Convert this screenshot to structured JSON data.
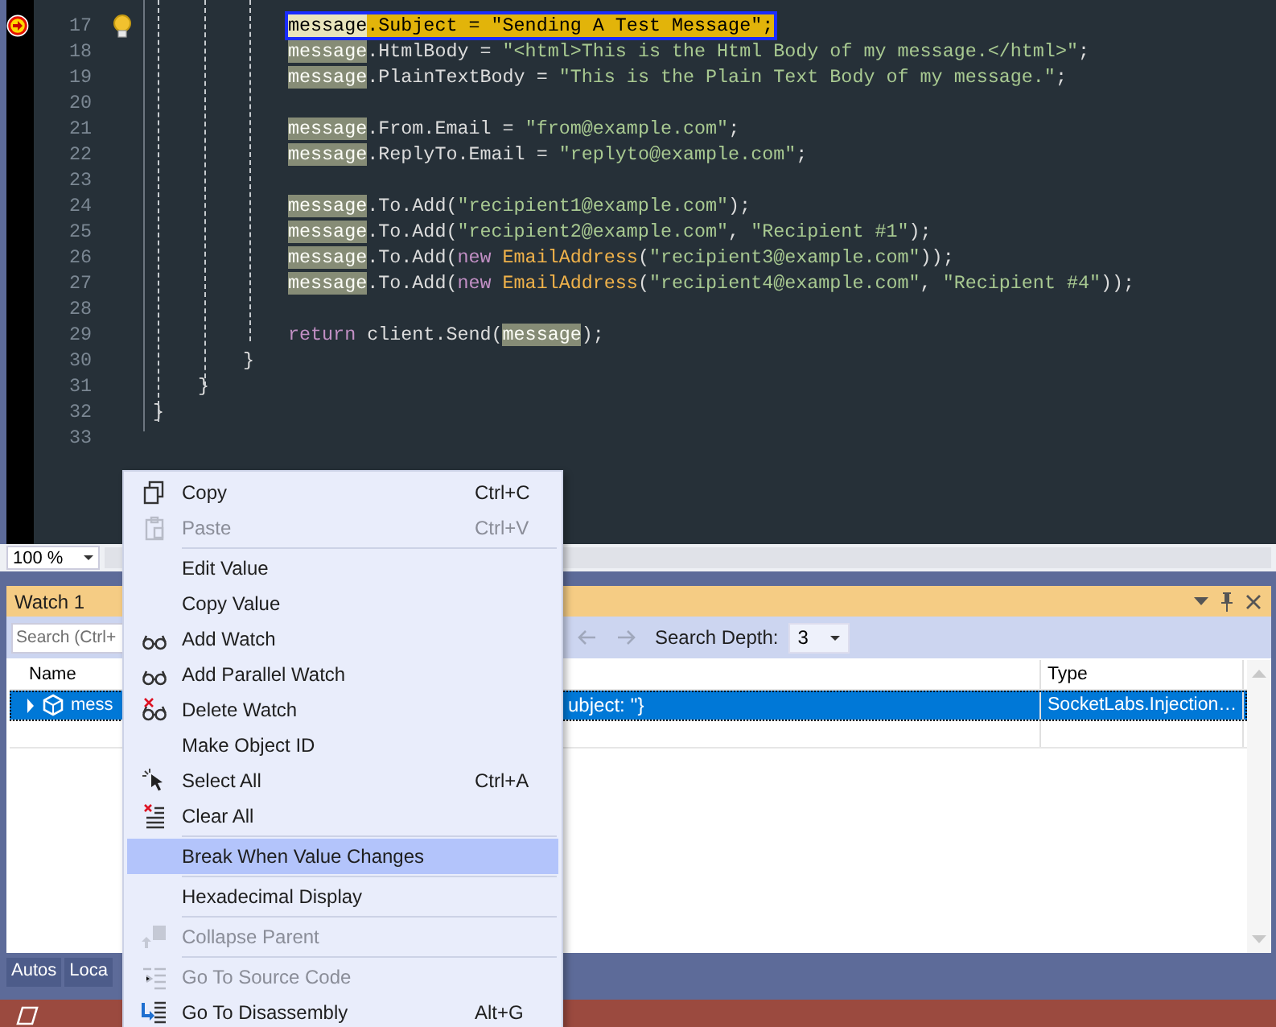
{
  "editor": {
    "lines": [
      {
        "children": [
          {
            "children": [
              {
                "children": [
                  {
                    "number": "17",
                    "current": true,
                    "breakpoint": true,
                    "lightbulb": true,
                    "tokens": [
                      {
                        "text": "message",
                        "kind": "ref"
                      },
                      {
                        "text": ".Subject = ",
                        "kind": "plain"
                      },
                      {
                        "text": "\"Sending A Test Message\"",
                        "kind": "string"
                      },
                      {
                        "text": ";",
                        "kind": "plain"
                      }
                    ]
                  },
                  {
                    "number": "18",
                    "current": false,
                    "breakpoint": false,
                    "lightbulb": false,
                    "tokens": [
                      {
                        "text": "message",
                        "kind": "ref"
                      },
                      {
                        "text": ".HtmlBody = ",
                        "kind": "plain"
                      },
                      {
                        "text": "\"<html>This is the Html Body of my message.</html>\"",
                        "kind": "string"
                      },
                      {
                        "text": ";",
                        "kind": "plain"
                      }
                    ]
                  },
                  {
                    "number": "19",
                    "current": false,
                    "breakpoint": false,
                    "lightbulb": false,
                    "tokens": [
                      {
                        "text": "message",
                        "kind": "ref"
                      },
                      {
                        "text": ".PlainTextBody = ",
                        "kind": "plain"
                      },
                      {
                        "text": "\"This is the Plain Text Body of my message.\"",
                        "kind": "string"
                      },
                      {
                        "text": ";",
                        "kind": "plain"
                      }
                    ]
                  },
                  {
                    "number": "20",
                    "current": false,
                    "breakpoint": false,
                    "lightbulb": false
                  },
                  {
                    "number": "21",
                    "current": false,
                    "breakpoint": false,
                    "lightbulb": false,
                    "tokens": [
                      {
                        "text": "message",
                        "kind": "ref"
                      },
                      {
                        "text": ".From.Email = ",
                        "kind": "plain"
                      },
                      {
                        "text": "\"from@example.com\"",
                        "kind": "string"
                      },
                      {
                        "text": ";",
                        "kind": "plain"
                      }
                    ]
                  },
                  {
                    "number": "22",
                    "current": false,
                    "breakpoint": false,
                    "lightbulb": false,
                    "tokens": [
                      {
                        "text": "message",
                        "kind": "ref"
                      },
                      {
                        "text": ".ReplyTo.Email = ",
                        "kind": "plain"
                      },
                      {
                        "text": "\"replyto@example.com\"",
                        "kind": "string"
                      },
                      {
                        "text": ";",
                        "kind": "plain"
                      }
                    ]
                  },
                  {
                    "number": "23",
                    "current": false,
                    "breakpoint": false,
                    "lightbulb": false
                  },
                  {
                    "number": "24",
                    "current": false,
                    "breakpoint": false,
                    "lightbulb": false,
                    "tokens": [
                      {
                        "text": "message",
                        "kind": "ref"
                      },
                      {
                        "text": ".To.Add(",
                        "kind": "plain"
                      },
                      {
                        "text": "\"recipient1@example.com\"",
                        "kind": "string"
                      },
                      {
                        "text": ");",
                        "kind": "plain"
                      }
                    ]
                  },
                  {
                    "number": "25",
                    "current": false,
                    "breakpoint": false,
                    "lightbulb": false,
                    "tokens": [
                      {
                        "text": "message",
                        "kind": "ref"
                      },
                      {
                        "text": ".To.Add(",
                        "kind": "plain"
                      },
                      {
                        "text": "\"recipient2@example.com\"",
                        "kind": "string"
                      },
                      {
                        "text": ", ",
                        "kind": "plain"
                      },
                      {
                        "text": "\"Recipient #1\"",
                        "kind": "string"
                      },
                      {
                        "text": ");",
                        "kind": "plain"
                      }
                    ]
                  },
                  {
                    "number": "26",
                    "current": false,
                    "breakpoint": false,
                    "lightbulb": false,
                    "tokens": [
                      {
                        "text": "message",
                        "kind": "ref"
                      },
                      {
                        "text": ".To.Add(",
                        "kind": "plain"
                      },
                      {
                        "text": "new ",
                        "kind": "keyword"
                      },
                      {
                        "text": "EmailAddress",
                        "kind": "type"
                      },
                      {
                        "text": "(",
                        "kind": "plain"
                      },
                      {
                        "text": "\"recipient3@example.com\"",
                        "kind": "string"
                      },
                      {
                        "text": "));",
                        "kind": "plain"
                      }
                    ]
                  },
                  {
                    "number": "27",
                    "current": false,
                    "breakpoint": false,
                    "lightbulb": false,
                    "tokens": [
                      {
                        "text": "message",
                        "kind": "ref"
                      },
                      {
                        "text": ".To.Add(",
                        "kind": "plain"
                      },
                      {
                        "text": "new ",
                        "kind": "keyword"
                      },
                      {
                        "text": "EmailAddress",
                        "kind": "type"
                      },
                      {
                        "text": "(",
                        "kind": "plain"
                      },
                      {
                        "text": "\"recipient4@example.com\"",
                        "kind": "string"
                      },
                      {
                        "text": ", ",
                        "kind": "plain"
                      },
                      {
                        "text": "\"Recipient #4\"",
                        "kind": "string"
                      },
                      {
                        "text": "));",
                        "kind": "plain"
                      }
                    ]
                  },
                  {
                    "number": "28",
                    "current": false,
                    "breakpoint": false,
                    "lightbulb": false
                  },
                  {
                    "number": "29",
                    "current": false,
                    "breakpoint": false,
                    "lightbulb": false,
                    "tokens": [
                      {
                        "text": "return",
                        "kind": "keyword"
                      },
                      {
                        "text": " client.Send(",
                        "kind": "plain"
                      },
                      {
                        "text": "message",
                        "kind": "ref"
                      },
                      {
                        "text": ");",
                        "kind": "plain"
                      }
                    ]
                  }
                ]
              },
              {
                "number": "30",
                "current": false,
                "breakpoint": false,
                "lightbulb": false,
                "tokens": [
                  {
                    "text": "}",
                    "kind": "plain"
                  }
                ]
              }
            ]
          },
          {
            "number": "31",
            "current": false,
            "breakpoint": false,
            "lightbulb": false,
            "tokens": [
              {
                "text": "}",
                "kind": "plain"
              }
            ]
          }
        ]
      },
      {
        "number": "32",
        "current": false,
        "breakpoint": false,
        "lightbulb": false,
        "tokens": [
          {
            "text": "}",
            "kind": "plain"
          }
        ]
      },
      {
        "number": "33",
        "current": false,
        "breakpoint": false,
        "lightbulb": false
      }
    ],
    "zoom": "100 %"
  },
  "watch": {
    "title": "Watch 1",
    "search": {
      "placeholder": "Search (Ctrl+"
    },
    "search_depth_label": "Search Depth:",
    "search_depth": "3",
    "columns": [
      {
        "label": "Name"
      },
      {
        "label": "Type"
      }
    ],
    "rows": [
      {
        "name": "mess",
        "value": "ubject: ''}",
        "type": "SocketLabs.Injection…",
        "selected": true,
        "expanded": false
      }
    ]
  },
  "bottom_tabs": [
    {
      "label": "Autos"
    },
    {
      "label": "Loca"
    }
  ],
  "context_menu": [
    {
      "kind": "item",
      "label": "Copy",
      "shortcut": "Ctrl+C",
      "disabled": false,
      "selected": false
    },
    {
      "kind": "item",
      "label": "Paste",
      "shortcut": "Ctrl+V",
      "disabled": true,
      "selected": false
    },
    {
      "kind": "separator"
    },
    {
      "kind": "item",
      "label": "Edit Value",
      "disabled": false,
      "selected": false
    },
    {
      "kind": "item",
      "label": "Copy Value",
      "disabled": false,
      "selected": false
    },
    {
      "kind": "item",
      "label": "Add Watch",
      "disabled": false,
      "selected": false
    },
    {
      "kind": "item",
      "label": "Add Parallel Watch",
      "disabled": false,
      "selected": false
    },
    {
      "kind": "item",
      "label": "Delete Watch",
      "disabled": false,
      "selected": false
    },
    {
      "kind": "item",
      "label": "Make Object ID",
      "disabled": false,
      "selected": false
    },
    {
      "kind": "item",
      "label": "Select All",
      "shortcut": "Ctrl+A",
      "disabled": false,
      "selected": false
    },
    {
      "kind": "item",
      "label": "Clear All",
      "disabled": false,
      "selected": false
    },
    {
      "kind": "separator"
    },
    {
      "kind": "item",
      "label": "Break When Value Changes",
      "disabled": false,
      "selected": true
    },
    {
      "kind": "separator"
    },
    {
      "kind": "item",
      "label": "Hexadecimal Display",
      "disabled": false,
      "selected": false
    },
    {
      "kind": "separator"
    },
    {
      "kind": "item",
      "label": "Collapse Parent",
      "disabled": true,
      "selected": false
    },
    {
      "kind": "separator"
    },
    {
      "kind": "item",
      "label": "Go To Source Code",
      "disabled": true,
      "selected": false
    },
    {
      "kind": "item",
      "label": "Go To Disassembly",
      "shortcut": "Alt+G",
      "disabled": false,
      "selected": false
    }
  ]
}
